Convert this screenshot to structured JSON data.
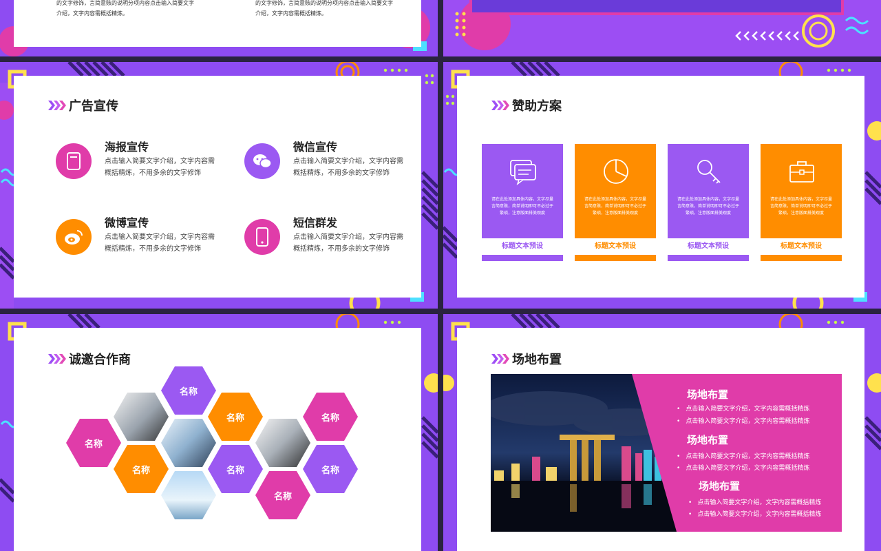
{
  "colors": {
    "purple": "#9b59f2",
    "orange": "#ff8d00",
    "pink": "#e03ca9",
    "violet_bg": "#8e4cf2"
  },
  "top_left": {
    "col1": [
      "的文字修饰，言简意赅的说明分项内容点击输入简要文字",
      "介绍，文字内容需概括精炼。"
    ],
    "col2": [
      "的文字修饰，言简意赅的说明分项内容点击输入简要文字",
      "介绍，文字内容需概括精炼。"
    ]
  },
  "ad": {
    "title": "广告宣传",
    "items": [
      {
        "heading": "海报宣传",
        "desc": "点击输入简要文字介绍，文字内容需概括精炼，不用多余的文字修饰",
        "icon": "poster-icon",
        "color": "#e03ca9"
      },
      {
        "heading": "微信宣传",
        "desc": "点击输入简要文字介绍，文字内容需概括精炼，不用多余的文字修饰",
        "icon": "wechat-icon",
        "color": "#9b59f2"
      },
      {
        "heading": "微博宣传",
        "desc": "点击输入简要文字介绍，文字内容需概括精炼，不用多余的文字修饰",
        "icon": "weibo-icon",
        "color": "#ff8d00"
      },
      {
        "heading": "短信群发",
        "desc": "点击输入简要文字介绍，文字内容需概括精炼，不用多余的文字修饰",
        "icon": "phone-icon",
        "color": "#e03ca9"
      }
    ]
  },
  "sponsor": {
    "title": "赞助方案",
    "cards": [
      {
        "text": "请在此处添加具体内容，文字尽量言简意赅，简单说明即可不必过于繁琐，注意版面排美观度",
        "label": "标题文本预设",
        "icon": "message-icon",
        "color": "#9b59f2"
      },
      {
        "text": "请在此处添加具体内容，文字尽量言简意赅，简单说明即可不必过于繁琐，注意版面排美观度",
        "label": "标题文本预设",
        "icon": "pie-chart-icon",
        "color": "#ff8d00"
      },
      {
        "text": "请在此处添加具体内容，文字尽量言简意赅，简单说明即可不必过于繁琐，注意版面排美观度",
        "label": "标题文本预设",
        "icon": "key-icon",
        "color": "#9b59f2"
      },
      {
        "text": "请在此处添加具体内容，文字尽量言简意赅，简单说明即可不必过于繁琐，注意版面排美观度",
        "label": "标题文本预设",
        "icon": "briefcase-icon",
        "color": "#ff8d00"
      }
    ]
  },
  "partners": {
    "title": "诚邀合作商",
    "names": [
      "名称",
      "名称",
      "名称",
      "名称",
      "名称",
      "名称",
      "名称",
      "名称"
    ]
  },
  "venue": {
    "title": "场地布置",
    "sections": [
      {
        "heading": "场地布置",
        "lines": [
          "点击输入简要文字介绍，文字内容需概括精炼",
          "点击输入简要文字介绍，文字内容需概括精炼"
        ]
      },
      {
        "heading": "场地布置",
        "lines": [
          "点击输入简要文字介绍，文字内容需概括精炼",
          "点击输入简要文字介绍，文字内容需概括精炼"
        ]
      },
      {
        "heading": "场地布置",
        "lines": [
          "点击输入简要文字介绍，文字内容需概括精炼",
          "点击输入简要文字介绍，文字内容需概括精炼"
        ]
      }
    ]
  }
}
